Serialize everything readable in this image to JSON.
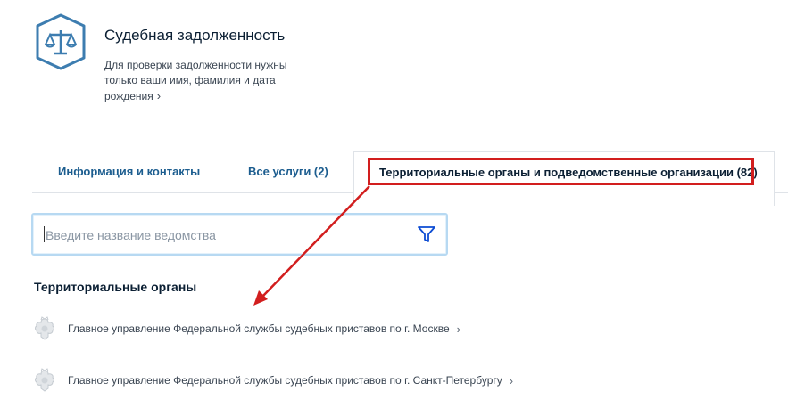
{
  "service": {
    "title": "Судебная задолженность",
    "description": "Для проверки задолженности нужны только ваши имя, фамилия и дата рождения",
    "chevron": "›",
    "icon": "scales-icon"
  },
  "tabs": [
    {
      "label": "Информация и контакты"
    },
    {
      "label": "Все услуги (2)"
    },
    {
      "label": "Территориальные органы и подведомственные организации (82)",
      "active": true
    }
  ],
  "search": {
    "placeholder": "Введите название ведомства",
    "value": "",
    "filter_icon": "filter-icon"
  },
  "section": {
    "title": "Территориальные органы"
  },
  "orgs": [
    {
      "label": "Главное управление Федеральной службы судебных приставов по г. Москве",
      "icon": "coat-of-arms-icon"
    },
    {
      "label": "Главное управление Федеральной службы судебных приставов по г. Санкт-Петербургу",
      "icon": "coat-of-arms-icon"
    }
  ],
  "colors": {
    "accent": "#0d4cd3",
    "tab_link": "#1c5d8f",
    "icon_stroke": "#3d7db0",
    "annotation_red": "#d21e1e",
    "search_border": "#b7d9f2"
  }
}
